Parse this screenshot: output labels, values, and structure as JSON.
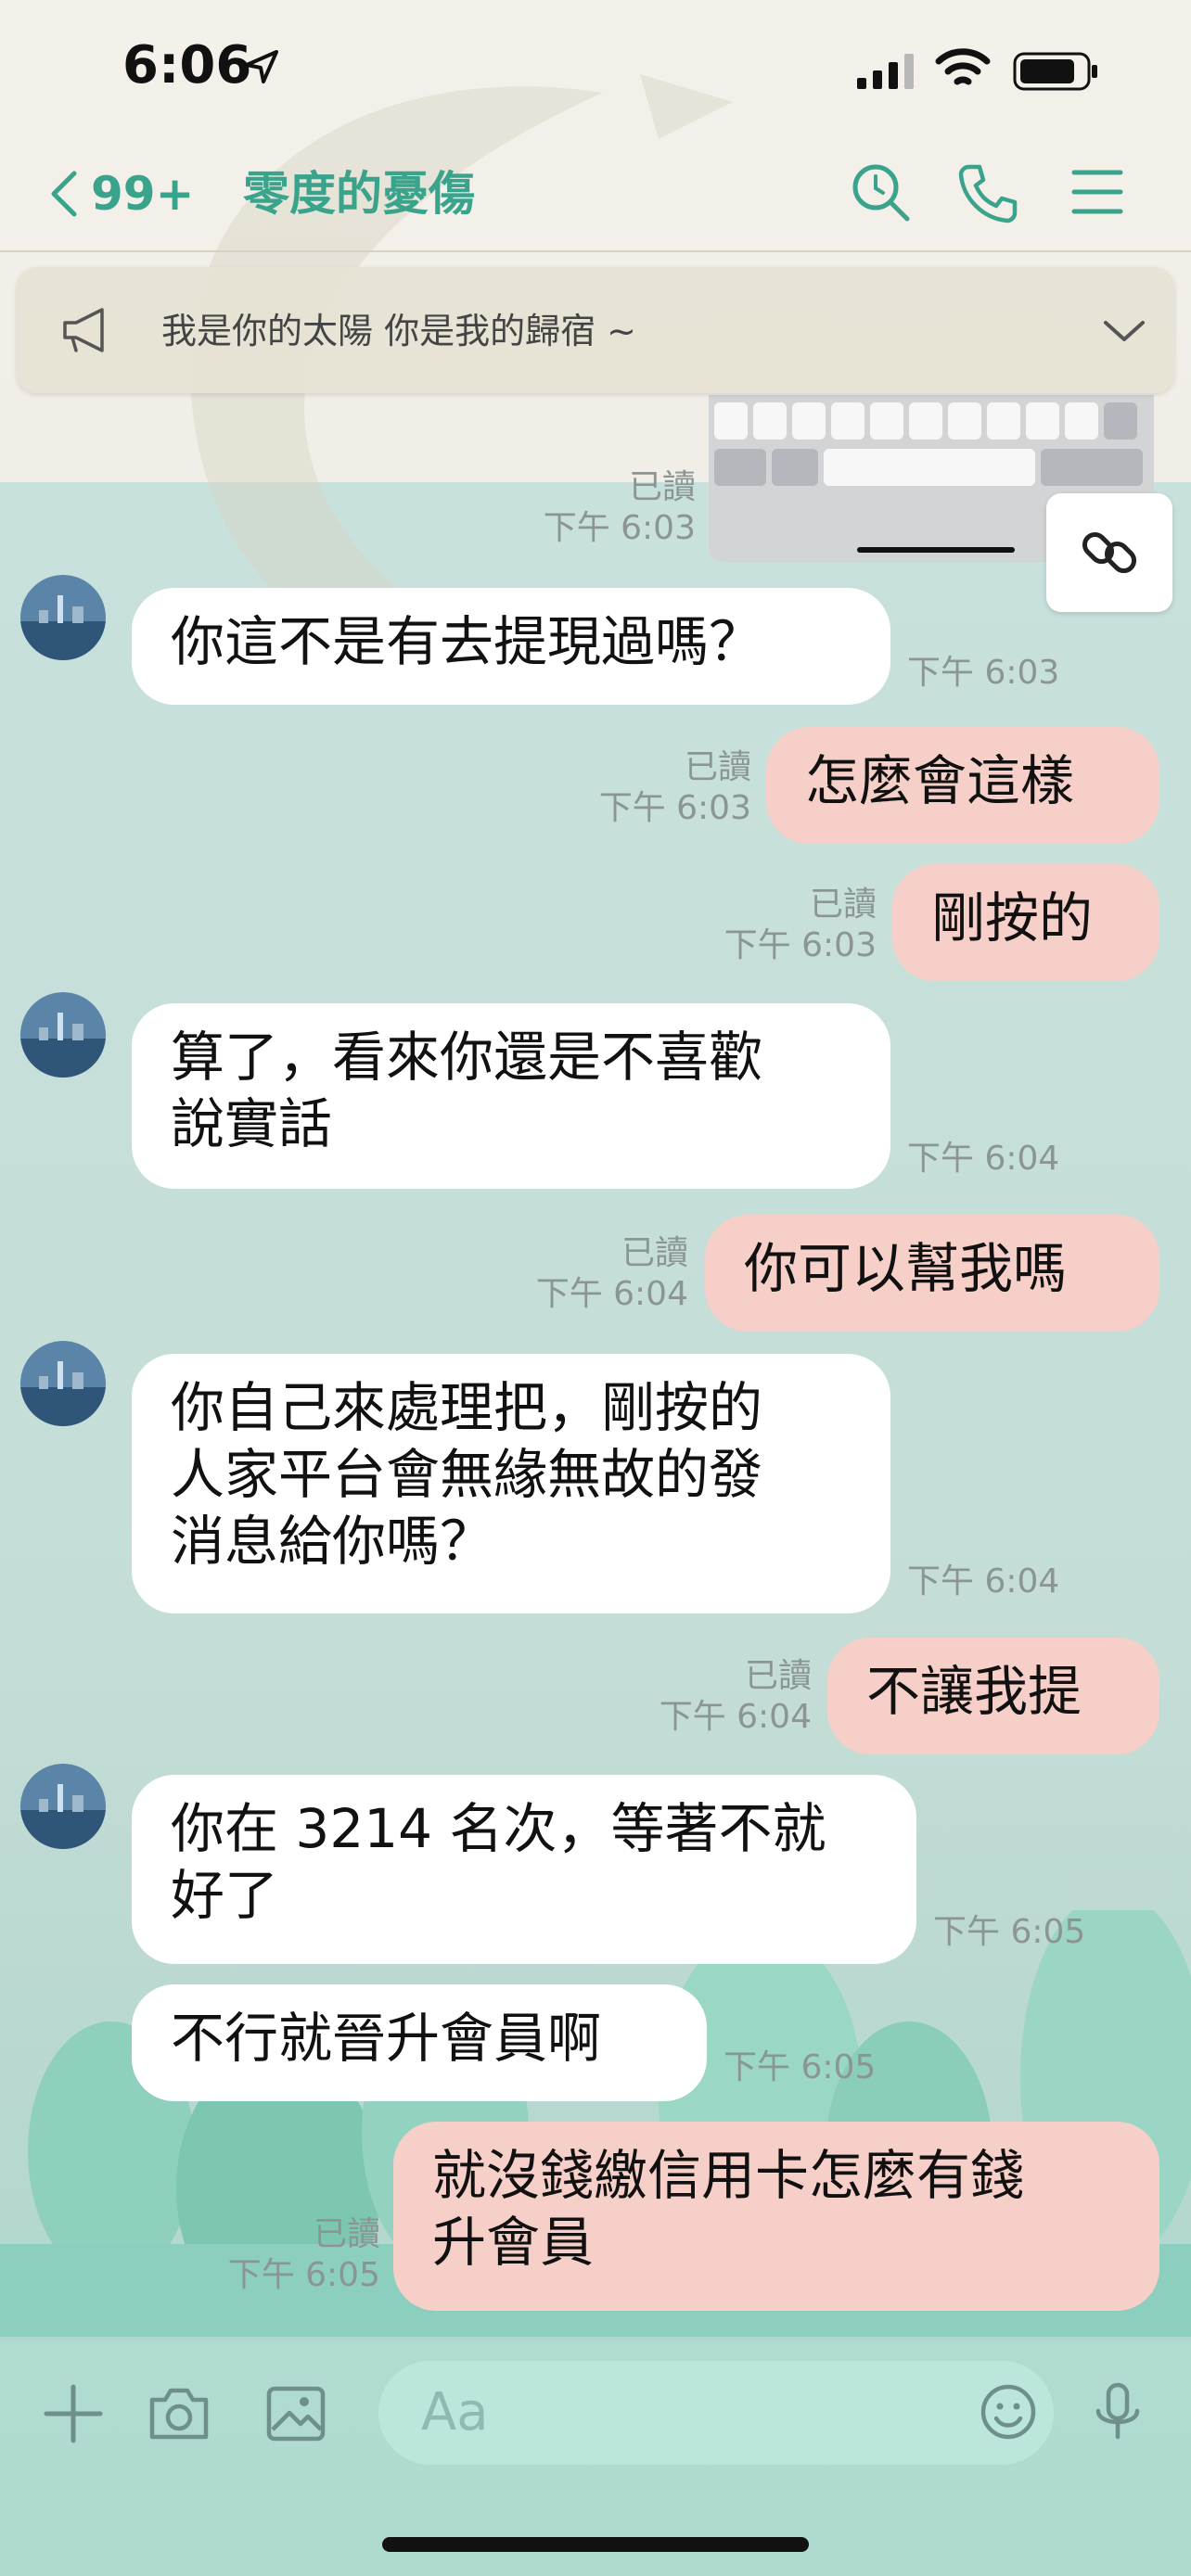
{
  "status_bar": {
    "time": "6:06"
  },
  "header": {
    "back_count": "99+",
    "title": "零度的憂傷",
    "icons": [
      "search-icon",
      "phone-icon",
      "menu-icon"
    ]
  },
  "announcement": {
    "text": "我是你的太陽 你是我的歸宿 ~"
  },
  "top_meta": {
    "read": "已讀",
    "time": "下午 6:03"
  },
  "messages": [
    {
      "side": "in",
      "lines": [
        "你這不是有去提現過嗎？"
      ],
      "time": "下午 6:03"
    },
    {
      "side": "out",
      "lines": [
        "怎麼會這樣"
      ],
      "read": "已讀",
      "time": "下午 6:03"
    },
    {
      "side": "out",
      "lines": [
        "剛按的"
      ],
      "read": "已讀",
      "time": "下午 6:03"
    },
    {
      "side": "in",
      "lines": [
        "算了，看來你還是不喜歡",
        "說實話"
      ],
      "time": "下午 6:04"
    },
    {
      "side": "out",
      "lines": [
        "你可以幫我嗎"
      ],
      "read": "已讀",
      "time": "下午 6:04"
    },
    {
      "side": "in",
      "lines": [
        "你自己來處理把，剛按的",
        "人家平台會無緣無故的發",
        "消息給你嗎？"
      ],
      "time": "下午 6:04"
    },
    {
      "side": "out",
      "lines": [
        "不讓我提"
      ],
      "read": "已讀",
      "time": "下午 6:04"
    },
    {
      "side": "in",
      "lines": [
        "你在 3214 名次，等著不就",
        "好了"
      ],
      "time": "下午 6:05"
    },
    {
      "side": "in",
      "lines": [
        "不行就晉升會員啊"
      ],
      "time": "下午 6:05"
    },
    {
      "side": "out",
      "lines": [
        "就沒錢繳信用卡怎麼有錢",
        "升會員"
      ],
      "read": "已讀",
      "time": "下午 6:05"
    }
  ],
  "input": {
    "placeholder": "Aa"
  },
  "colors": {
    "accent": "#3aa38c",
    "incoming": "#ffffff",
    "outgoing": "#f6cfc8"
  }
}
